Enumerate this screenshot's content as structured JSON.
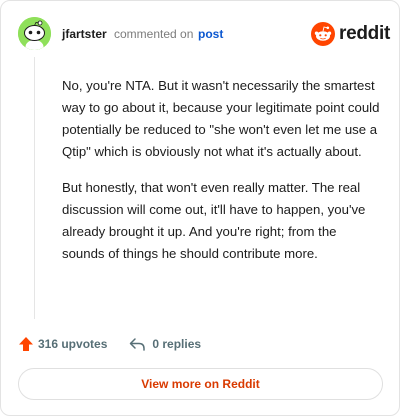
{
  "header": {
    "username": "jfartster",
    "commented_on": "commented on",
    "post_link": "post",
    "brand": "reddit"
  },
  "comment": {
    "paragraphs": [
      "No, you're NTA. But it wasn't necessarily the smartest way to go about it, because your legitimate point could potentially be reduced to \"she won't even let me use a Qtip\" which is obviously not what it's actually about.",
      "But honestly, that won't even really matter. The real discussion will come out, it'll have to happen, you've already brought it up. And you're right; from the sounds of things he should contribute more."
    ]
  },
  "footer": {
    "upvotes": "316 upvotes",
    "replies": "0 replies",
    "view_more": "View more on Reddit"
  },
  "colors": {
    "accent": "#d93a00",
    "upvote": "#ff4500",
    "avatar": "#8fe05a",
    "link": "#0b57d0"
  },
  "icons": [
    "snoo-avatar-icon",
    "reddit-logo-icon",
    "upvote-arrow-icon",
    "reply-arrow-icon"
  ]
}
